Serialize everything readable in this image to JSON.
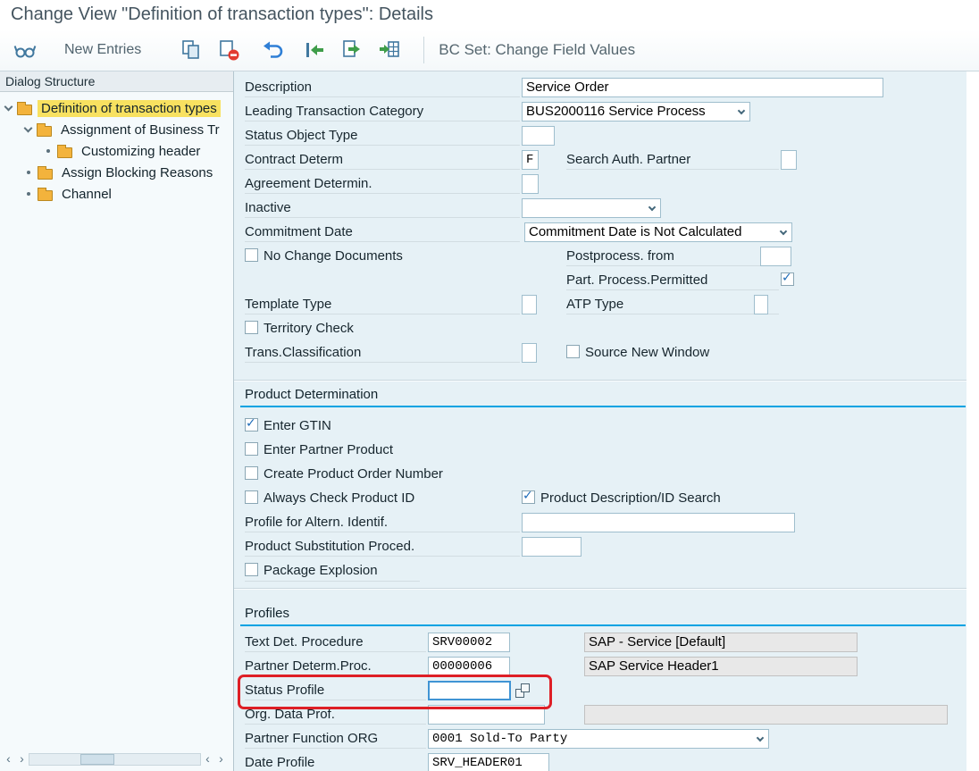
{
  "title": "Change View \"Definition of transaction types\": Details",
  "toolbar": {
    "new_entries": "New Entries",
    "bc_set": "BC Set: Change Field Values",
    "icon_names": [
      "display-change-icon",
      "copy-icon",
      "delete-row-icon",
      "undo-icon",
      "back-icon",
      "next-entry-icon",
      "import-entries-icon"
    ]
  },
  "sidebar": {
    "header": "Dialog Structure",
    "items": [
      {
        "label": "Definition of transaction types",
        "selected": true
      },
      {
        "label": "Assignment of Business Tr",
        "selected": false
      },
      {
        "label": "Customizing header",
        "selected": false
      },
      {
        "label": "Assign Blocking Reasons",
        "selected": false
      },
      {
        "label": "Channel",
        "selected": false
      }
    ],
    "scrollbar": {
      "left_arrow": "‹",
      "right_arrow": "›"
    }
  },
  "form": {
    "description": {
      "label": "Description",
      "value": "Service Order"
    },
    "leading_category": {
      "label": "Leading Transaction Category",
      "value": "BUS2000116 Service Process"
    },
    "status_object_type": {
      "label": "Status Object Type",
      "value": ""
    },
    "contract_determ": {
      "label": "Contract Determ",
      "value": "F"
    },
    "search_auth_partner": {
      "label": "Search Auth. Partner",
      "value": ""
    },
    "agreement_determin": {
      "label": "Agreement Determin.",
      "value": ""
    },
    "inactive": {
      "label": "Inactive",
      "value": ""
    },
    "commitment_date": {
      "label": "Commitment Date",
      "value": "Commitment Date is Not Calculated"
    },
    "no_change_documents": {
      "label": "No Change Documents",
      "checked": false
    },
    "postprocess_from": {
      "label": "Postprocess. from",
      "value": ""
    },
    "part_process_permitted": {
      "label": "Part. Process.Permitted",
      "checked": true
    },
    "template_type": {
      "label": "Template Type",
      "value": ""
    },
    "atp_type": {
      "label": "ATP Type",
      "value": ""
    },
    "territory_check": {
      "label": "Territory Check",
      "checked": false
    },
    "trans_classification": {
      "label": "Trans.Classification",
      "value": ""
    },
    "source_new_window": {
      "label": "Source New Window",
      "checked": false
    }
  },
  "product_determination": {
    "header": "Product Determination",
    "enter_gtin": {
      "label": "Enter GTIN",
      "checked": true
    },
    "enter_partner_product": {
      "label": "Enter Partner Product",
      "checked": false
    },
    "create_product_order_number": {
      "label": "Create Product Order Number",
      "checked": false
    },
    "always_check_product_id": {
      "label": "Always Check Product ID",
      "checked": false
    },
    "product_description_id_search": {
      "label": "Product Description/ID Search",
      "checked": true
    },
    "profile_altern_identif": {
      "label": "Profile for Altern. Identif.",
      "value": ""
    },
    "product_substitution_proced": {
      "label": "Product Substitution Proced.",
      "value": ""
    },
    "package_explosion": {
      "label": "Package Explosion",
      "checked": false
    }
  },
  "profiles": {
    "header": "Profiles",
    "text_det_procedure": {
      "label": "Text Det. Procedure",
      "value": "SRV00002",
      "description": "SAP - Service [Default]"
    },
    "partner_determ_proc": {
      "label": "Partner Determ.Proc.",
      "value": "00000006",
      "description": "SAP Service Header1"
    },
    "status_profile": {
      "label": "Status Profile",
      "value": ""
    },
    "org_data_prof": {
      "label": "Org. Data Prof.",
      "value": "",
      "description": ""
    },
    "partner_function_org": {
      "label": "Partner Function ORG",
      "value": "0001 Sold-To Party"
    },
    "date_profile": {
      "label": "Date Profile",
      "value": "SRV_HEADER01"
    }
  }
}
